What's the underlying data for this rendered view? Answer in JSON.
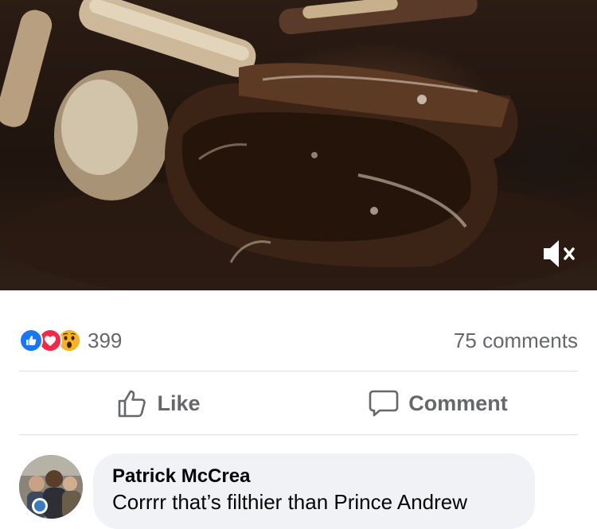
{
  "video": {
    "description_icon": "mute-speaker-icon"
  },
  "reactions": {
    "types": [
      "like",
      "love",
      "wow"
    ],
    "count": "399",
    "comments_label": "75 comments"
  },
  "actions": {
    "like_label": "Like",
    "comment_label": "Comment"
  },
  "comment": {
    "author": "Patrick McCrea",
    "text": "Corrrr that’s filthier than Prince Andrew"
  },
  "colors": {
    "like": "#1877f2",
    "love": "#f02849",
    "wow": "#f7b125",
    "secondary_text": "#65676b",
    "bubble": "#f0f2f5"
  }
}
